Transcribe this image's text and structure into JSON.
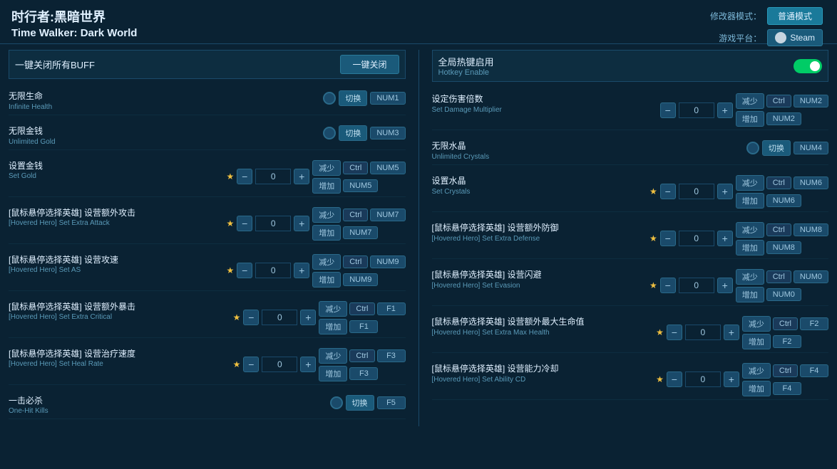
{
  "header": {
    "title_cn": "时行者:黑暗世界",
    "title_en": "Time Walker: Dark World",
    "mode_label": "修改器模式：",
    "mode_value": "普通模式",
    "platform_label": "游戏平台：",
    "platform_value": "Steam"
  },
  "left": {
    "one_key_label": "一键关闭所有BUFF",
    "one_key_btn": "一键关闭",
    "cheats": [
      {
        "cn": "无限生命",
        "en": "Infinite Health",
        "type": "toggle",
        "key": "切换",
        "num": "NUM1"
      },
      {
        "cn": "无限金钱",
        "en": "Unlimited Gold",
        "type": "toggle",
        "key": "切换",
        "num": "NUM3"
      },
      {
        "cn": "设置金钱",
        "en": "Set Gold",
        "type": "stepper",
        "value": "0",
        "star": true,
        "key_dec": "减少",
        "ctrl_dec": "Ctrl",
        "num_dec": "NUM5",
        "key_inc": "增加",
        "num_inc": "NUM5"
      },
      {
        "cn": "[鼠标悬停选择英雄] 设营额外攻击",
        "en": "[Hovered Hero] Set Extra Attack",
        "type": "stepper",
        "value": "0",
        "star": true,
        "key_dec": "减少",
        "ctrl_dec": "Ctrl",
        "num_dec": "NUM7",
        "key_inc": "增加",
        "num_inc": "NUM7"
      },
      {
        "cn": "[鼠标悬停选择英雄] 设营攻速",
        "en": "[Hovered Hero] Set AS",
        "type": "stepper",
        "value": "0",
        "star": true,
        "key_dec": "减少",
        "ctrl_dec": "Ctrl",
        "num_dec": "NUM9",
        "key_inc": "增加",
        "num_inc": "NUM9"
      },
      {
        "cn": "[鼠标悬停选择英雄] 设营额外暴击",
        "en": "[Hovered Hero] Set Extra Critical",
        "type": "stepper",
        "value": "0",
        "star": true,
        "key_dec": "减少",
        "ctrl_dec": "Ctrl",
        "num_dec": "F1",
        "key_inc": "增加",
        "num_inc": "F1"
      },
      {
        "cn": "[鼠标悬停选择英雄] 设营治疗速度",
        "en": "[Hovered Hero] Set Heal Rate",
        "type": "stepper",
        "value": "0",
        "star": true,
        "key_dec": "减少",
        "ctrl_dec": "Ctrl",
        "num_dec": "F3",
        "key_inc": "增加",
        "num_inc": "F3"
      },
      {
        "cn": "一击必杀",
        "en": "One-Hit Kills",
        "type": "toggle",
        "key": "切换",
        "num": "F5"
      }
    ]
  },
  "right": {
    "hotkey_cn": "全局热键启用",
    "hotkey_en": "Hotkey Enable",
    "cheats": [
      {
        "cn": "设定伤害倍数",
        "en": "Set Damage Multiplier",
        "type": "stepper",
        "value": "0",
        "key_dec": "减少",
        "ctrl_dec": "Ctrl",
        "num_dec": "NUM2",
        "key_inc": "增加",
        "num_inc": "NUM2"
      },
      {
        "cn": "无限水晶",
        "en": "Unlimited Crystals",
        "type": "toggle",
        "key": "切换",
        "num": "NUM4"
      },
      {
        "cn": "设置水晶",
        "en": "Set Crystals",
        "type": "stepper",
        "value": "0",
        "star": true,
        "key_dec": "减少",
        "ctrl_dec": "Ctrl",
        "num_dec": "NUM6",
        "key_inc": "增加",
        "num_inc": "NUM6"
      },
      {
        "cn": "[鼠标悬停选择英雄] 设营额外防御",
        "en": "[Hovered Hero] Set Extra Defense",
        "type": "stepper",
        "value": "0",
        "star": true,
        "key_dec": "减少",
        "ctrl_dec": "Ctrl",
        "num_dec": "NUM8",
        "key_inc": "增加",
        "num_inc": "NUM8"
      },
      {
        "cn": "[鼠标悬停选择英雄] 设营闪避",
        "en": "[Hovered Hero] Set Evasion",
        "type": "stepper",
        "value": "0",
        "star": true,
        "key_dec": "减少",
        "ctrl_dec": "Ctrl",
        "num_dec": "NUM0",
        "key_inc": "增加",
        "num_inc": "NUM0"
      },
      {
        "cn": "[鼠标悬停选择英雄] 设营额外最大生命值",
        "en": "[Hovered Hero] Set Extra Max Health",
        "type": "stepper",
        "value": "0",
        "star": true,
        "key_dec": "减少",
        "ctrl_dec": "Ctrl",
        "num_dec": "F2",
        "key_inc": "增加",
        "num_inc": "F2"
      },
      {
        "cn": "[鼠标悬停选择英雄] 设营能力冷却",
        "en": "[Hovered Hero] Set Ability CD",
        "type": "stepper",
        "value": "0",
        "star": true,
        "key_dec": "减少",
        "ctrl_dec": "Ctrl",
        "num_dec": "F4",
        "key_inc": "增加",
        "num_inc": "F4"
      }
    ]
  }
}
